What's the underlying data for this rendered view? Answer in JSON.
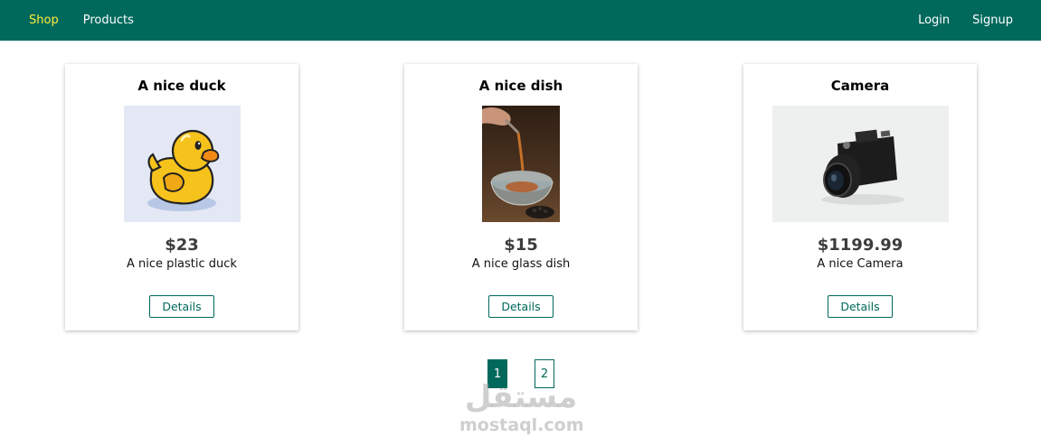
{
  "nav": {
    "left": [
      {
        "label": "Shop",
        "active": true
      },
      {
        "label": "Products",
        "active": false
      }
    ],
    "right": [
      {
        "label": "Login"
      },
      {
        "label": "Signup"
      }
    ]
  },
  "products": [
    {
      "title": "A nice duck",
      "price": "$23",
      "description": "A nice plastic duck",
      "button": "Details",
      "image": "duck-image"
    },
    {
      "title": "A nice dish",
      "price": "$15",
      "description": "A nice glass dish",
      "button": "Details",
      "image": "dish-photo"
    },
    {
      "title": "Camera",
      "price": "$1199.99",
      "description": "A nice Camera",
      "button": "Details",
      "image": "camera-photo"
    }
  ],
  "pagination": {
    "pages": [
      "1",
      "2"
    ],
    "current": "1"
  },
  "watermark": {
    "arabic": "مستقل",
    "latin": "mostaql.com"
  },
  "colors": {
    "primary": "#00695c",
    "active_nav": "#ffeb3b"
  }
}
